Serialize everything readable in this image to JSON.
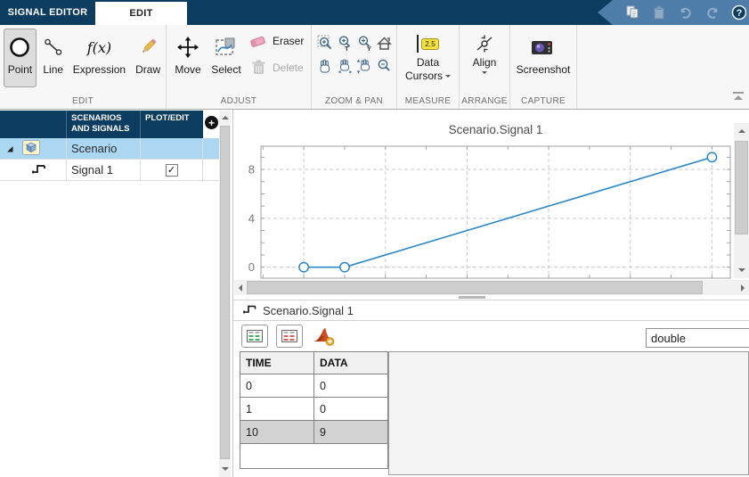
{
  "app": {
    "titlebar": {
      "tab_signal_editor": "SIGNAL EDITOR",
      "tab_edit": "EDIT"
    },
    "colors": {
      "titlebar_navy": "#0d3c61",
      "qat_blue": "#4e7da9",
      "tree_selection_blue": "#abd7f2",
      "signal_line_blue": "#2a87c8",
      "selected_tool_gray": "#dcdcdc"
    }
  },
  "ribbon": {
    "edit": {
      "label": "EDIT",
      "point": "Point",
      "line": "Line",
      "expression": "Expression",
      "draw": "Draw"
    },
    "adjust": {
      "label": "ADJUST",
      "move": "Move",
      "select": "Select",
      "eraser": "Eraser",
      "delete": "Delete"
    },
    "zoom_pan": {
      "label": "ZOOM & PAN"
    },
    "measure": {
      "label": "MEASURE",
      "data_line1": "Data",
      "data_line2": "Cursors",
      "badge": "2.5"
    },
    "arrange": {
      "label": "ARRANGE",
      "align": "Align"
    },
    "capture": {
      "label": "CAPTURE",
      "screenshot": "Screenshot"
    }
  },
  "tree": {
    "columns": {
      "signals": "SCENARIOS AND SIGNALS",
      "plot_edit": "PLOT/EDIT"
    },
    "rows": [
      {
        "label": "Scenario",
        "type": "scenario",
        "selected": true,
        "expanded": true
      },
      {
        "label": "Signal 1",
        "type": "signal",
        "plot_edit_checked": true
      }
    ]
  },
  "chart_data": {
    "type": "line",
    "title": "Scenario.Signal 1",
    "x": [
      0,
      1,
      10
    ],
    "y": [
      0,
      0,
      9
    ],
    "xlim": [
      -1.05,
      10.45
    ],
    "ylim": [
      -0.9,
      9.9
    ],
    "xticks_major": [
      0,
      2,
      4,
      6,
      8,
      10
    ],
    "xticks_minor_step": 1,
    "yticks_major": [
      0,
      4,
      8
    ],
    "ytick_labels": [
      "0",
      "4",
      "8"
    ],
    "yticks_minor_step": 1,
    "grid": "dashed",
    "legend": "none",
    "line_color": "#2a87c8",
    "marker": "circle"
  },
  "signal_panel": {
    "tab_label": "Scenario.Signal 1",
    "datatype_value": "double",
    "table": {
      "headers": [
        "TIME",
        "DATA"
      ],
      "rows": [
        [
          "0",
          "0"
        ],
        [
          "1",
          "0"
        ],
        [
          "10",
          "9"
        ]
      ],
      "selected_row_index": 2
    }
  },
  "icons": {
    "help_glyph": "?",
    "expression_glyph": "f(x)",
    "zoom_time_glyph": "T",
    "zoom_y_glyph": "Y",
    "add_glyph": "+",
    "check_glyph": "✓"
  }
}
